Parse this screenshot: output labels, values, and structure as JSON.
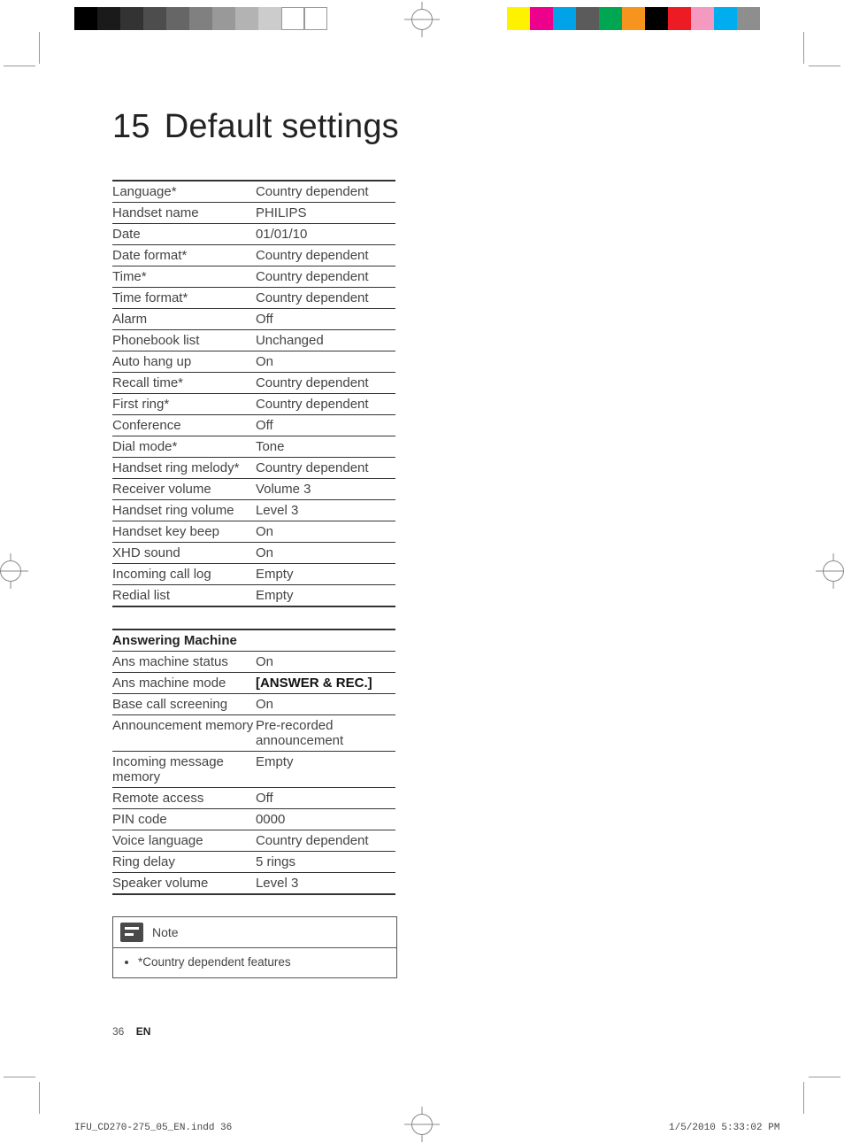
{
  "chapter_number": "15",
  "chapter_title": "Default settings",
  "settings": [
    {
      "label": "Language*",
      "value": "Country dependent"
    },
    {
      "label": "Handset name",
      "value": "PHILIPS"
    },
    {
      "label": "Date",
      "value": "01/01/10"
    },
    {
      "label": "Date format*",
      "value": "Country dependent"
    },
    {
      "label": "Time*",
      "value": "Country dependent"
    },
    {
      "label": "Time format*",
      "value": "Country dependent"
    },
    {
      "label": "Alarm",
      "value": "Off"
    },
    {
      "label": "Phonebook list",
      "value": "Unchanged"
    },
    {
      "label": "Auto hang up",
      "value": "On"
    },
    {
      "label": "Recall time*",
      "value": "Country dependent"
    },
    {
      "label": "First ring*",
      "value": "Country dependent"
    },
    {
      "label": "Conference",
      "value": "Off"
    },
    {
      "label": "Dial mode*",
      "value": "Tone"
    },
    {
      "label": "Handset ring melody*",
      "value": "Country dependent"
    },
    {
      "label": "Receiver volume",
      "value": "Volume 3"
    },
    {
      "label": "Handset ring volume",
      "value": "Level 3"
    },
    {
      "label": "Handset key beep",
      "value": "On"
    },
    {
      "label": "XHD sound",
      "value": "On"
    },
    {
      "label": "Incoming call log",
      "value": "Empty"
    },
    {
      "label": "Redial list",
      "value": "Empty"
    }
  ],
  "answering_header": "Answering Machine",
  "answering": [
    {
      "label": "Ans machine status",
      "value": "On"
    },
    {
      "label": "Ans machine mode",
      "value": "[ANSWER & REC.]",
      "bold": true
    },
    {
      "label": "Base call screening",
      "value": "On"
    },
    {
      "label": "Announcement memory",
      "value": "Pre-recorded announcement"
    },
    {
      "label": "Incoming message memory",
      "value": "Empty"
    },
    {
      "label": "Remote access",
      "value": "Off"
    },
    {
      "label": "PIN code",
      "value": "0000"
    },
    {
      "label": "Voice language",
      "value": "Country dependent"
    },
    {
      "label": "Ring delay",
      "value": "5 rings"
    },
    {
      "label": "Speaker volume",
      "value": "Level 3"
    }
  ],
  "note_label": "Note",
  "note_item": "*Country dependent features",
  "page_number": "36",
  "page_lang": "EN",
  "slug_file": "IFU_CD270-275_05_EN.indd   36",
  "slug_datetime": "1/5/2010   5:33:02 PM",
  "colorbars": {
    "left": [
      "#000000",
      "#1a1a1a",
      "#333333",
      "#4d4d4d",
      "#666666",
      "#808080",
      "#999999",
      "#b3b3b3",
      "#cccccc",
      "#ffffff",
      "#ffffff"
    ],
    "right": [
      "#fff200",
      "#ec008c",
      "#00a2e8",
      "#5b5b5b",
      "#00a651",
      "#f7941d",
      "#000000",
      "#ed1c24",
      "#f49ac1",
      "#00aeef",
      "#8e8e8e"
    ]
  }
}
